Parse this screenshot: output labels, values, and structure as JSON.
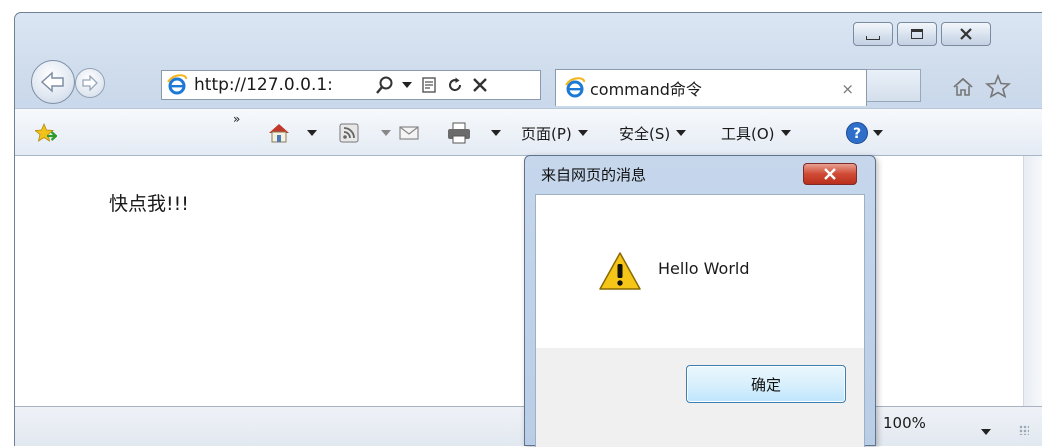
{
  "browser": {
    "address_url": "http://127.0.0.1:",
    "tab_title": "command命令",
    "tab_close": "×",
    "commands": {
      "chevron": "»",
      "page_menu": "页面(P)",
      "safety_menu": "安全(S)",
      "tools_menu": "工具(O)"
    },
    "zoom_level": "100%"
  },
  "page": {
    "link_text": "快点我!!!"
  },
  "dialog": {
    "title": "来自网页的消息",
    "message": "Hello World",
    "ok_label": "确定"
  },
  "icons": {
    "back": "back-arrow-icon",
    "forward": "forward-arrow-icon",
    "ie": "ie-logo-icon",
    "search": "search-icon",
    "compat": "compatibility-view-icon",
    "refresh": "refresh-icon",
    "stop": "stop-icon",
    "home": "home-icon",
    "favorites": "favorites-star-icon",
    "rss": "rss-feed-icon",
    "mail": "mail-icon",
    "print": "print-icon",
    "help": "help-icon",
    "warning": "warning-icon"
  },
  "colors": {
    "frame": "#cfdcec",
    "dialog_frame": "#b9cde6",
    "close_red": "#cf4a34",
    "ok_blue": "#3c7fb1"
  }
}
